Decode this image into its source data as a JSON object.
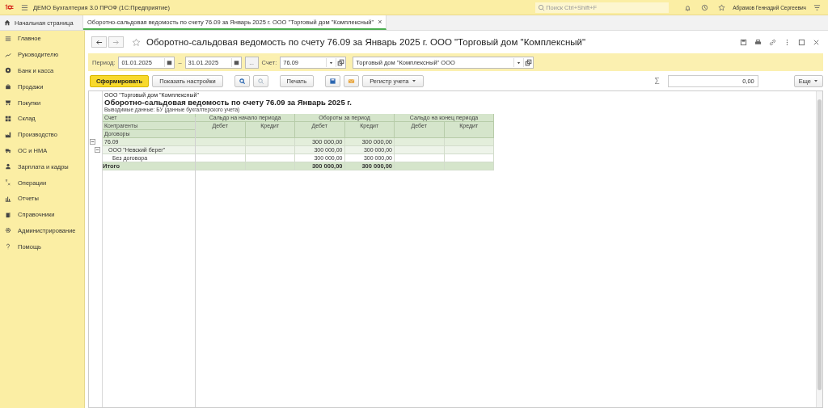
{
  "top_bar": {
    "app_title": "ДЕМО Бухгалтерия 3.0 ПРОФ  (1С:Предприятие)",
    "search": {
      "placeholder": "Поиск Ctrl+Shift+F"
    },
    "user": "Абрамов Геннадий Сергеевич"
  },
  "tabs": [
    {
      "label": "Начальная страница",
      "selected": false,
      "kind": "home"
    },
    {
      "label": "Оборотно-сальдовая ведомость по счету 76.09 за Январь 2025 г. ООО \"Торговый дом \"Комплексный\"",
      "selected": true,
      "kind": "document",
      "close": "×"
    }
  ],
  "sidebar": {
    "items": [
      {
        "label": "Главное"
      },
      {
        "label": "Руководителю"
      },
      {
        "label": "Банк и касса"
      },
      {
        "label": "Продажи"
      },
      {
        "label": "Покупки"
      },
      {
        "label": "Склад"
      },
      {
        "label": "Производство"
      },
      {
        "label": "ОС и НМА"
      },
      {
        "label": "Зарплата и кадры"
      },
      {
        "label": "Операции"
      },
      {
        "label": "Отчеты"
      },
      {
        "label": "Справочники"
      },
      {
        "label": "Администрирование"
      },
      {
        "label": "Помощь"
      }
    ]
  },
  "report": {
    "title": "Оборотно-сальдовая ведомость по счету 76.09 за Январь 2025 г. ООО \"Торговый дом \"Комплексный\"",
    "filters": {
      "period_label": "Период:",
      "date_from": "01.01.2025",
      "dash": "–",
      "date_to": "31.01.2025",
      "choose": "...",
      "account_label": "Счет:",
      "account": "76.09",
      "organization": "Торговый дом \"Комплексный\" ООО"
    },
    "toolbar": {
      "generate": "Сформировать",
      "settings": "Показать настройки",
      "print": "Печать",
      "register": "Регистр учета",
      "sum_sign": "Σ",
      "sum": "0,00",
      "more": "Еще"
    },
    "document": {
      "organization": "ООО \"Торговый дом \"Комплексный\"",
      "title": "Оборотно-сальдовая ведомость по счету 76.09 за Январь 2025 г.",
      "note": "Выводимые данные: БУ (данные бухгалтерского учета)"
    },
    "table": {
      "row_headers": [
        "Счет",
        "Контрагенты",
        "Договоры"
      ],
      "groups": [
        "Сальдо на начало периода",
        "Обороты за период",
        "Сальдо на конец периода"
      ],
      "subcolumns": [
        "Дебет",
        "Кредит",
        "Дебет",
        "Кредит",
        "Дебет",
        "Кредит"
      ],
      "rows": [
        {
          "label": "76.09",
          "expanded": true,
          "values": {
            "turnover_debit": "300 000,00",
            "turnover_credit": "300 000,00"
          },
          "children": [
            {
              "label": "ООО \"Невский берег\"",
              "expanded": true,
              "values": {
                "turnover_debit": "300 000,00",
                "turnover_credit": "300 000,00"
              },
              "children": [
                {
                  "label": "Без договора",
                  "values": {
                    "turnover_debit": "300 000,00",
                    "turnover_credit": "300 000,00"
                  }
                }
              ]
            }
          ]
        }
      ],
      "total": {
        "label": "Итого",
        "values": {
          "turnover_debit": "300 000,00",
          "turnover_credit": "300 000,00"
        }
      }
    }
  }
}
